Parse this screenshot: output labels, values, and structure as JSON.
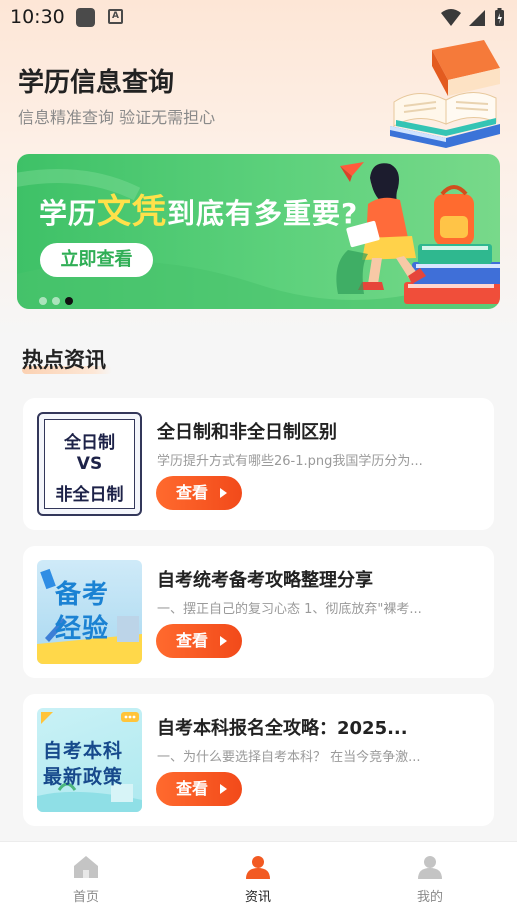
{
  "status_bar": {
    "time": "10:30",
    "notification_icon": "A",
    "icons": [
      "wifi-icon",
      "signal-icon",
      "battery-icon"
    ]
  },
  "header": {
    "title": "学历信息查询",
    "subtitle": "信息精准查询 验证无需担心"
  },
  "banner": {
    "title_prefix": "学历",
    "title_highlight": "文凭",
    "title_suffix": "到底有多重要?",
    "button_label": "立即查看",
    "dot_count": 3,
    "active_dot": 2,
    "colors": {
      "background": "#3ec167",
      "highlight": "#ffe14a"
    }
  },
  "section": {
    "title": "热点资讯"
  },
  "articles": [
    {
      "title": "全日制和非全日制区别",
      "desc": "学历提升方式有哪些26-1.png我国学历分为...",
      "button_label": "查看",
      "thumb_lines": [
        "全日制",
        "VS",
        "非全日制"
      ]
    },
    {
      "title": "自考统考备考攻略整理分享",
      "desc": "一、摆正自己的复习心态 1、彻底放弃\"裸考...",
      "button_label": "查看",
      "thumb_lines": [
        "备考",
        "经验"
      ]
    },
    {
      "title": "自考本科报名全攻略：2025...",
      "desc": "一、为什么要选择自考本科？ 在当今竞争激...",
      "button_label": "查看",
      "thumb_lines": [
        "自考本科",
        "最新政策"
      ]
    }
  ],
  "bottom_nav": {
    "items": [
      {
        "label": "首页",
        "icon": "home-icon",
        "active": false
      },
      {
        "label": "资讯",
        "icon": "news-icon",
        "active": true
      },
      {
        "label": "我的",
        "icon": "user-icon",
        "active": false
      }
    ],
    "active_color": "#f25a22"
  }
}
